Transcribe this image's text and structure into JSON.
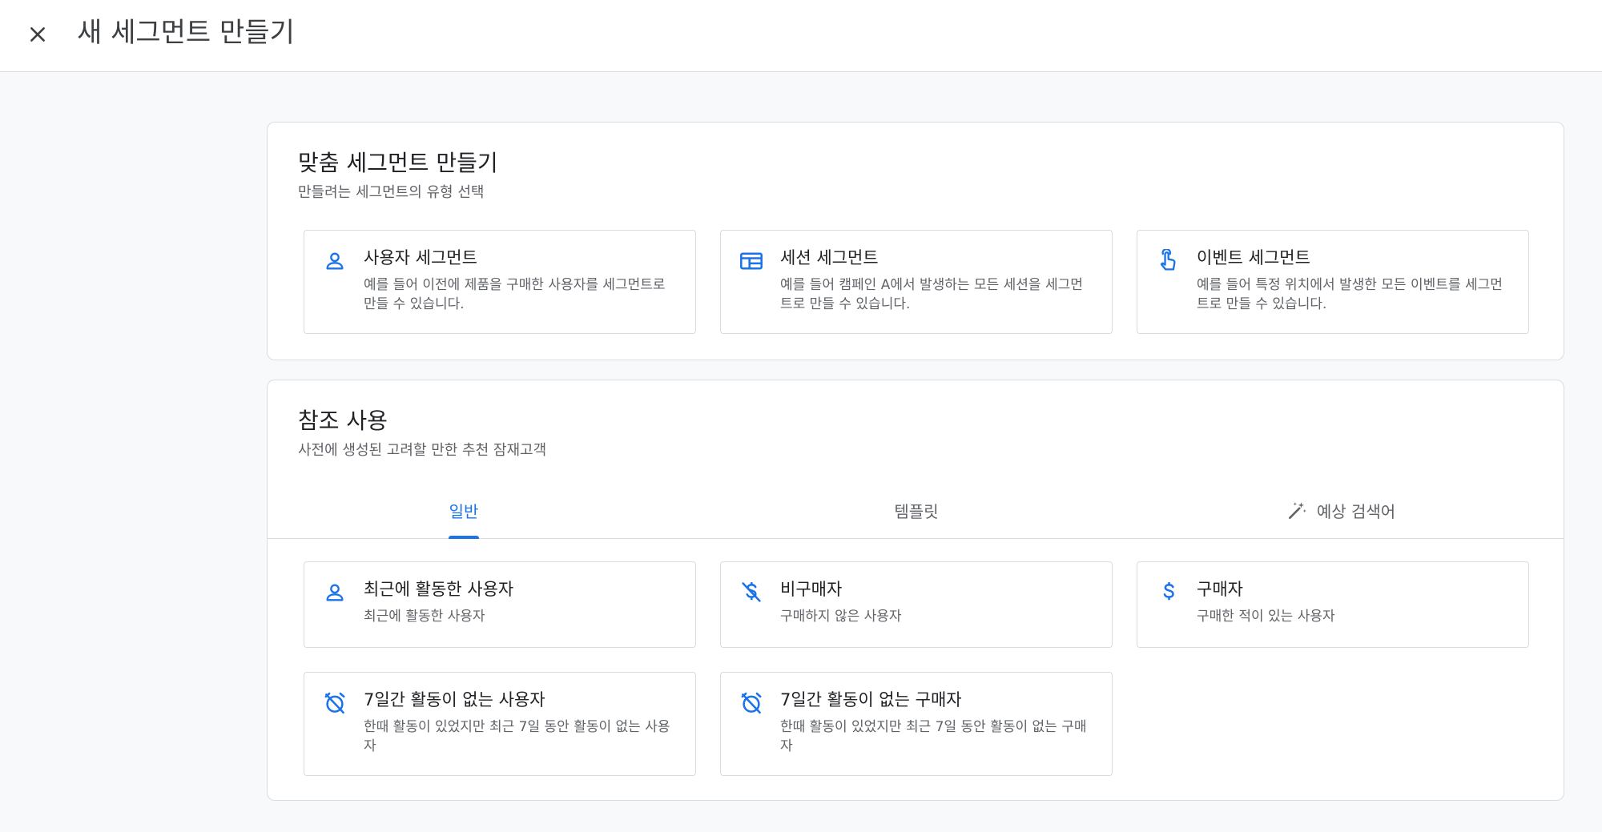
{
  "header": {
    "title": "새 세그먼트 만들기",
    "close_icon": "close-icon"
  },
  "custom_section": {
    "title": "맞춤 세그먼트 만들기",
    "subtitle": "만들려는 세그먼트의 유형 선택",
    "cards": [
      {
        "icon": "person-icon",
        "title": "사용자 세그먼트",
        "desc": "예를 들어 이전에 제품을 구매한 사용자를 세그먼트로 만들 수 있습니다."
      },
      {
        "icon": "session-icon",
        "title": "세션 세그먼트",
        "desc": "예를 들어 캠페인 A에서 발생하는 모든 세션을 세그먼트로 만들 수 있습니다."
      },
      {
        "icon": "touch-icon",
        "title": "이벤트 세그먼트",
        "desc": "예를 들어 특정 위치에서 발생한 모든 이벤트를 세그먼트로 만들 수 있습니다."
      }
    ]
  },
  "reference_section": {
    "title": "참조 사용",
    "subtitle": "사전에 생성된 고려할 만한 추천 잠재고객",
    "tabs": [
      {
        "label": "일반",
        "active": true
      },
      {
        "label": "템플릿",
        "active": false
      },
      {
        "label": "예상 검색어",
        "active": false,
        "icon": "magic-wand-icon"
      }
    ],
    "cards": [
      {
        "icon": "person-icon",
        "title": "최근에 활동한 사용자",
        "desc": "최근에 활동한 사용자"
      },
      {
        "icon": "no-purchase-icon",
        "title": "비구매자",
        "desc": "구매하지 않은 사용자"
      },
      {
        "icon": "dollar-icon",
        "title": "구매자",
        "desc": "구매한 적이 있는 사용자"
      },
      {
        "icon": "alarm-off-icon",
        "title": "7일간 활동이 없는 사용자",
        "desc": "한때 활동이 있었지만 최근 7일 동안 활동이 없는 사용자"
      },
      {
        "icon": "alarm-off-icon",
        "title": "7일간 활동이 없는 구매자",
        "desc": "한때 활동이 있었지만 최근 7일 동안 활동이 없는 구매자"
      }
    ]
  },
  "colors": {
    "accent": "#1a73e8",
    "border": "#dadce0",
    "text": "#202124",
    "muted": "#5f6368",
    "background": "#f8f9fa"
  }
}
